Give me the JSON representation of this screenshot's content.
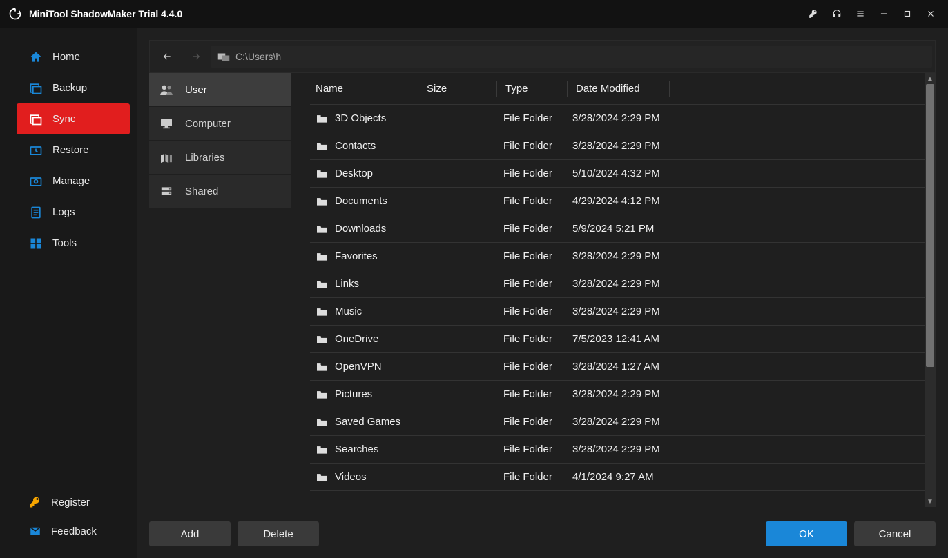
{
  "app": {
    "title": "MiniTool ShadowMaker Trial 4.4.0"
  },
  "sidebar": {
    "items": [
      {
        "label": "Home"
      },
      {
        "label": "Backup"
      },
      {
        "label": "Sync"
      },
      {
        "label": "Restore"
      },
      {
        "label": "Manage"
      },
      {
        "label": "Logs"
      },
      {
        "label": "Tools"
      }
    ],
    "bottom": [
      {
        "label": "Register"
      },
      {
        "label": "Feedback"
      }
    ]
  },
  "path": {
    "value": "C:\\Users\\h"
  },
  "tree": {
    "items": [
      {
        "label": "User"
      },
      {
        "label": "Computer"
      },
      {
        "label": "Libraries"
      },
      {
        "label": "Shared"
      }
    ]
  },
  "columns": {
    "name": "Name",
    "size": "Size",
    "type": "Type",
    "date": "Date Modified"
  },
  "files": [
    {
      "name": "3D Objects",
      "type": "File Folder",
      "date": "3/28/2024 2:29 PM"
    },
    {
      "name": "Contacts",
      "type": "File Folder",
      "date": "3/28/2024 2:29 PM"
    },
    {
      "name": "Desktop",
      "type": "File Folder",
      "date": "5/10/2024 4:32 PM"
    },
    {
      "name": "Documents",
      "type": "File Folder",
      "date": "4/29/2024 4:12 PM"
    },
    {
      "name": "Downloads",
      "type": "File Folder",
      "date": "5/9/2024 5:21 PM"
    },
    {
      "name": "Favorites",
      "type": "File Folder",
      "date": "3/28/2024 2:29 PM"
    },
    {
      "name": "Links",
      "type": "File Folder",
      "date": "3/28/2024 2:29 PM"
    },
    {
      "name": "Music",
      "type": "File Folder",
      "date": "3/28/2024 2:29 PM"
    },
    {
      "name": "OneDrive",
      "type": "File Folder",
      "date": "7/5/2023 12:41 AM"
    },
    {
      "name": "OpenVPN",
      "type": "File Folder",
      "date": "3/28/2024 1:27 AM"
    },
    {
      "name": "Pictures",
      "type": "File Folder",
      "date": "3/28/2024 2:29 PM"
    },
    {
      "name": "Saved Games",
      "type": "File Folder",
      "date": "3/28/2024 2:29 PM"
    },
    {
      "name": "Searches",
      "type": "File Folder",
      "date": "3/28/2024 2:29 PM"
    },
    {
      "name": "Videos",
      "type": "File Folder",
      "date": "4/1/2024 9:27 AM"
    }
  ],
  "footer": {
    "add": "Add",
    "delete": "Delete",
    "ok": "OK",
    "cancel": "Cancel"
  }
}
